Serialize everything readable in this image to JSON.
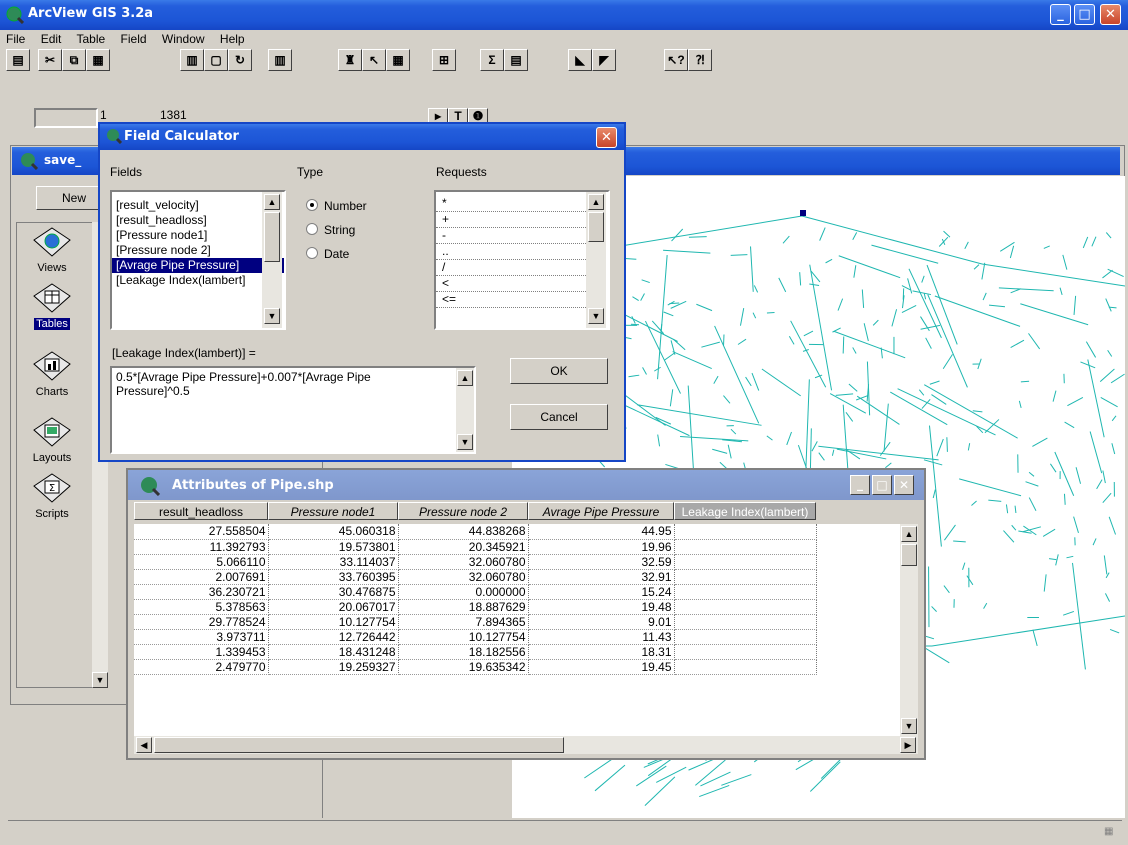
{
  "app": {
    "title": "ArcView GIS 3.2a"
  },
  "menu": [
    "File",
    "Edit",
    "Table",
    "Field",
    "Window",
    "Help"
  ],
  "toolbar2": {
    "record_info": "1",
    "record_total": "1381"
  },
  "project": {
    "title": "save_",
    "new_button": "New",
    "items": [
      "Views",
      "Tables",
      "Charts",
      "Layouts",
      "Scripts"
    ]
  },
  "field_calc": {
    "title": "Field Calculator",
    "fields_label": "Fields",
    "type_label": "Type",
    "requests_label": "Requests",
    "fields": [
      "[result_velocity]",
      "[result_headloss]",
      "[Pressure node1]",
      "[Pressure node 2]",
      "[Avrage Pipe Pressure]",
      "[Leakage Index(lambert]"
    ],
    "selected_field_index": 4,
    "types": [
      "Number",
      "String",
      "Date"
    ],
    "selected_type": "Number",
    "requests": [
      "*",
      "+",
      "-",
      "..",
      "/",
      "<",
      "<="
    ],
    "target_label": "[Leakage Index(lambert)] =",
    "expression": "0.5*[Avrage Pipe Pressure]+0.007*[Avrage Pipe Pressure]^0.5",
    "ok": "OK",
    "cancel": "Cancel"
  },
  "attributes": {
    "title": "Attributes of Pipe.shp",
    "columns": [
      "result_headloss",
      "Pressure node1",
      "Pressure node 2",
      "Avrage Pipe Pressure",
      "Leakage Index(lambert)"
    ],
    "rows": [
      [
        "27.558504",
        "45.060318",
        "44.838268",
        "44.95",
        ""
      ],
      [
        "11.392793",
        "19.573801",
        "20.345921",
        "19.96",
        ""
      ],
      [
        "5.066110",
        "33.114037",
        "32.060780",
        "32.59",
        ""
      ],
      [
        "2.007691",
        "33.760395",
        "32.060780",
        "32.91",
        ""
      ],
      [
        "36.230721",
        "30.476875",
        "0.000000",
        "15.24",
        ""
      ],
      [
        "5.378563",
        "20.067017",
        "18.887629",
        "19.48",
        ""
      ],
      [
        "29.778524",
        "10.127754",
        "7.894365",
        "9.01",
        ""
      ],
      [
        "3.973711",
        "12.726442",
        "10.127754",
        "11.43",
        ""
      ],
      [
        "1.339453",
        "18.431248",
        "18.182556",
        "18.31",
        ""
      ],
      [
        "2.479770",
        "19.259327",
        "19.635342",
        "19.45",
        ""
      ]
    ]
  },
  "colors": {
    "network": "#1fb7b0",
    "selection": "#000080",
    "titlebar": "#245edc"
  }
}
